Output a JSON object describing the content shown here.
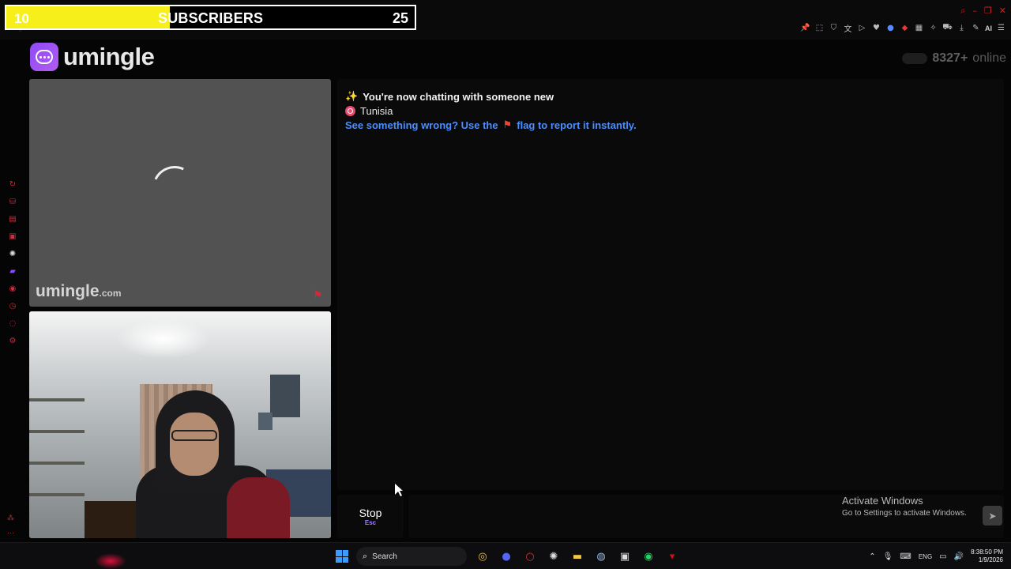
{
  "overlay": {
    "subscriber_start": "10",
    "subscriber_label": "SUBSCRIBERS",
    "subscriber_goal": "25",
    "progress_fraction": 0.4
  },
  "browser": {
    "address_hint": "umingle.com/video",
    "ai_label": "AI"
  },
  "header": {
    "logo_text": "umingle",
    "online_count": "8327+",
    "online_label": "online"
  },
  "stranger_video": {
    "watermark": "umingle",
    "watermark_suffix": ".com"
  },
  "chat": {
    "new_chat_message": "You're now chatting with someone new",
    "country": "Tunisia",
    "report_prefix": "See something wrong? Use the",
    "report_suffix": "flag to report it instantly."
  },
  "controls": {
    "stop_label": "Stop",
    "stop_key": "Esc",
    "message_placeholder": ""
  },
  "activation": {
    "title": "Activate Windows",
    "subtitle": "Go to Settings to activate Windows."
  },
  "taskbar": {
    "search_label": "Search",
    "language": "ENG",
    "time": "8:38:50 PM",
    "date": "1/9/2026"
  },
  "colors": {
    "overlay_fill": "#f6ef1a",
    "brand_purple": "#9b51f0",
    "link_blue": "#4a8eff",
    "accent_red": "#d42838"
  }
}
